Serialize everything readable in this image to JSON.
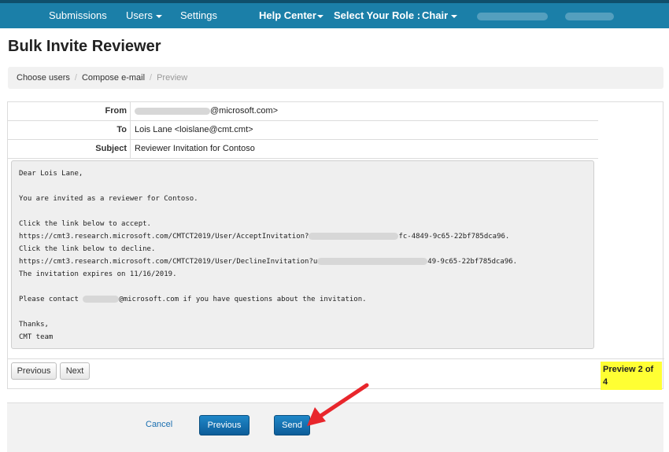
{
  "nav": {
    "submissions": "Submissions",
    "users": "Users",
    "settings": "Settings",
    "help_center": "Help Center",
    "role_label": "Select Your Role :",
    "role_value": "Chair"
  },
  "page": {
    "title": "Bulk Invite Reviewer"
  },
  "breadcrumb": {
    "items": [
      "Choose users",
      "Compose e-mail",
      "Preview"
    ],
    "separator": "/"
  },
  "email": {
    "from_label": "From",
    "from_value": "@microsoft.com>",
    "to_label": "To",
    "to_value": "Lois Lane <loislane@cmt.cmt>",
    "subject_label": "Subject",
    "subject_value": "Reviewer Invitation for Contoso",
    "body_lines": [
      "Dear Lois Lane,",
      "",
      "You are invited as a reviewer for Contoso.",
      "",
      "Click the link below to accept.",
      "https://cmt3.research.microsoft.com/CMTCT2019/User/AcceptInvitation?",
      "fc-4849-9c65-22bf785dca96.",
      "Click the link below to decline.",
      "https://cmt3.research.microsoft.com/CMTCT2019/User/DeclineInvitation?u",
      "49-9c65-22bf785dca96.",
      "The invitation expires on 11/16/2019.",
      "",
      "@microsoft.com if you have questions about the invitation.",
      "Please contact",
      "",
      "Thanks,",
      "CMT team"
    ]
  },
  "preview_nav": {
    "previous": "Previous",
    "next": "Next",
    "counter": "Preview 2 of 4"
  },
  "footer": {
    "cancel": "Cancel",
    "previous": "Previous",
    "send": "Send"
  },
  "colors": {
    "nav_bg": "#1b7fa8",
    "button_blue": "#0d5d99",
    "highlight": "#ffff33",
    "arrow": "#e8262c"
  }
}
